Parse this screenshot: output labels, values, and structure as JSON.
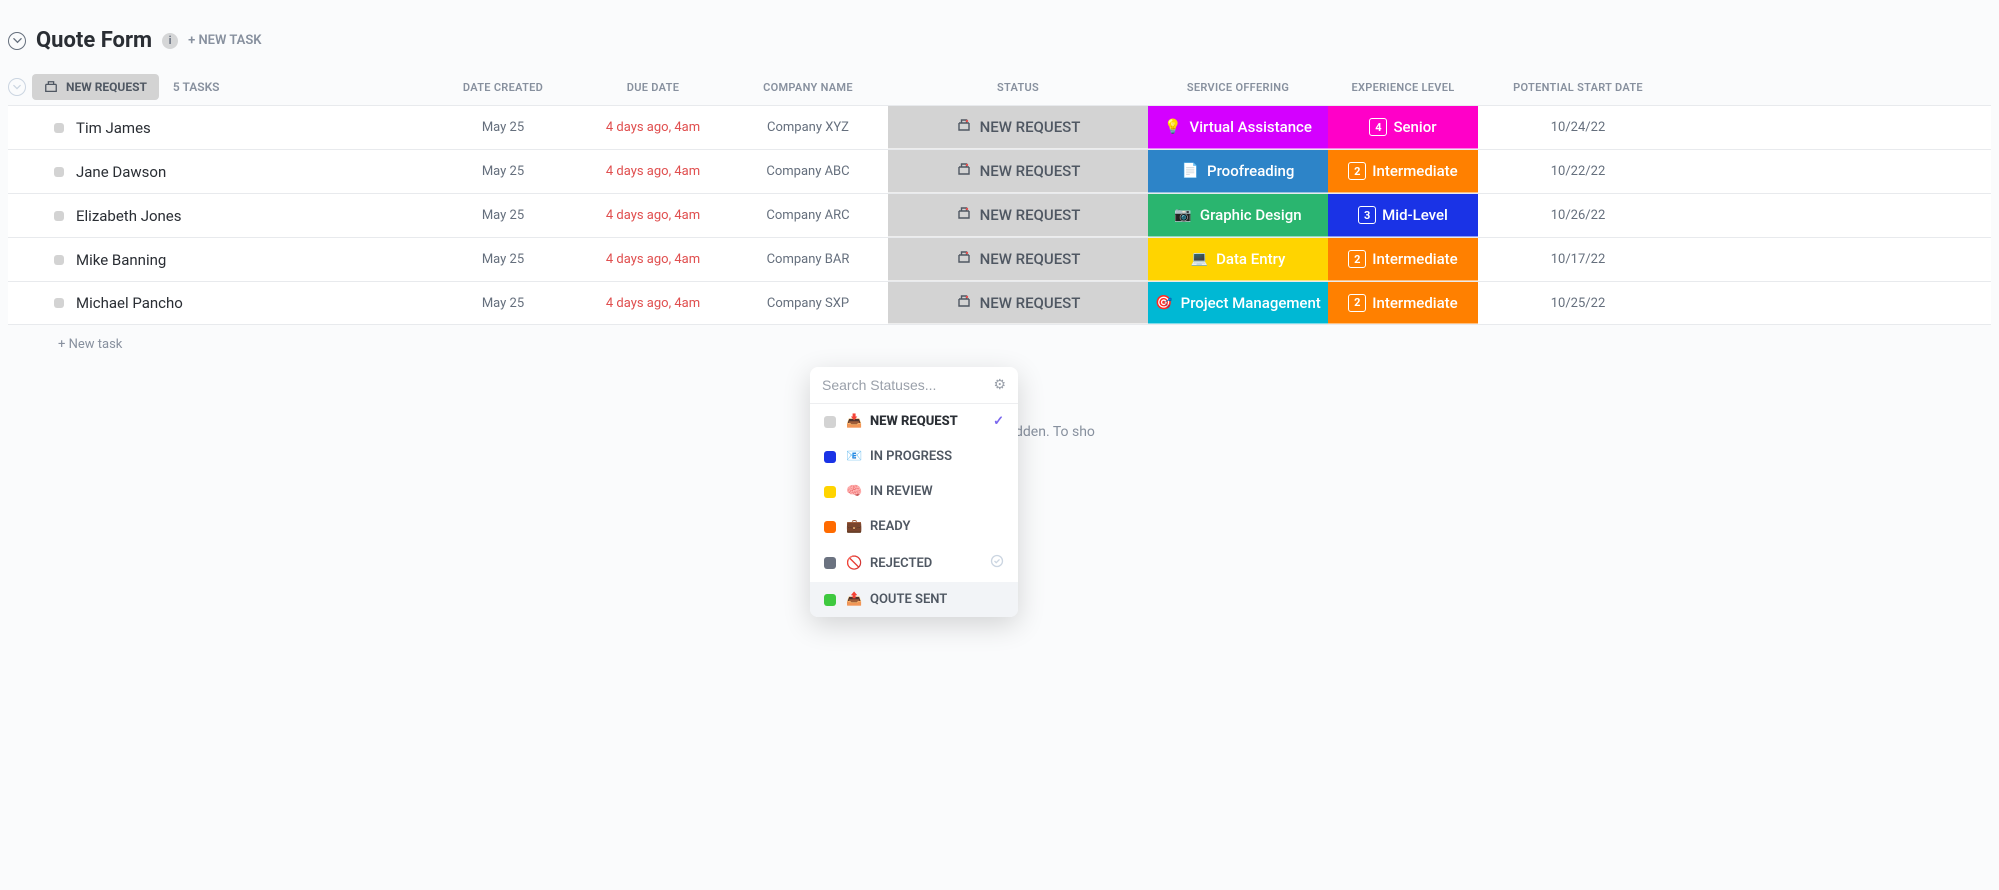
{
  "header": {
    "title": "Quote Form",
    "new_task_label": "+ NEW TASK"
  },
  "group": {
    "pill_label": "NEW REQUEST",
    "task_count": "5 TASKS"
  },
  "columns": {
    "date_created": "DATE CREATED",
    "due_date": "DUE DATE",
    "company_name": "COMPANY NAME",
    "status": "STATUS",
    "service_offering": "SERVICE OFFERING",
    "experience_level": "EXPERIENCE LEVEL",
    "potential_start_date": "POTENTIAL START DATE"
  },
  "rows": [
    {
      "name": "Tim James",
      "date_created": "May 25",
      "due_date": "4 days ago, 4am",
      "company": "Company XYZ",
      "status": "NEW REQUEST",
      "service": {
        "label": "Virtual Assistance",
        "icon": "💡",
        "bg": "#d400ff"
      },
      "experience": {
        "level": "4",
        "label": "Senior",
        "bg": "#ff00c8"
      },
      "start": "10/24/22"
    },
    {
      "name": "Jane Dawson",
      "date_created": "May 25",
      "due_date": "4 days ago, 4am",
      "company": "Company ABC",
      "status": "NEW REQUEST",
      "service": {
        "label": "Proofreading",
        "icon": "📄",
        "bg": "#2d84c8"
      },
      "experience": {
        "level": "2",
        "label": "Intermediate",
        "bg": "#ff8000"
      },
      "start": "10/22/22"
    },
    {
      "name": "Elizabeth Jones",
      "date_created": "May 25",
      "due_date": "4 days ago, 4am",
      "company": "Company ARC",
      "status": "NEW REQUEST",
      "service": {
        "label": "Graphic Design",
        "icon": "📷",
        "bg": "#2ab56f"
      },
      "experience": {
        "level": "3",
        "label": "Mid-Level",
        "bg": "#1a33e6"
      },
      "start": "10/26/22"
    },
    {
      "name": "Mike Banning",
      "date_created": "May 25",
      "due_date": "4 days ago, 4am",
      "company": "Company BAR",
      "status": "NEW REQUEST",
      "service": {
        "label": "Data Entry",
        "icon": "💻",
        "bg": "#ffd400"
      },
      "experience": {
        "level": "2",
        "label": "Intermediate",
        "bg": "#ff8000"
      },
      "start": "10/17/22"
    },
    {
      "name": "Michael Pancho",
      "date_created": "May 25",
      "due_date": "4 days ago, 4am",
      "company": "Company SXP",
      "status": "NEW REQUEST",
      "service": {
        "label": "Project Management",
        "icon": "🎯",
        "bg": "#00b8d4"
      },
      "experience": {
        "level": "2",
        "label": "Intermediate",
        "bg": "#ff8000"
      },
      "start": "10/25/22"
    }
  ],
  "new_task_inline": "+ New task",
  "hidden_message": "Some tasks are hidden. To sho",
  "dropdown": {
    "placeholder": "Search Statuses...",
    "items": [
      {
        "swatch": "#d3d3d3",
        "icon": "📥",
        "label": "NEW REQUEST",
        "selected": true,
        "bold": true
      },
      {
        "swatch": "#1a33e6",
        "icon": "📧",
        "label": "IN PROGRESS"
      },
      {
        "swatch": "#ffd400",
        "icon": "🧠",
        "label": "IN REVIEW"
      },
      {
        "swatch": "#ff6b00",
        "icon": "💼",
        "label": "READY"
      },
      {
        "swatch": "#6b7280",
        "icon": "🚫",
        "label": "REJECTED",
        "trailing_circle": true
      },
      {
        "swatch": "#3fc93f",
        "icon": "📤",
        "label": "QOUTE SENT",
        "hover": true
      }
    ]
  }
}
